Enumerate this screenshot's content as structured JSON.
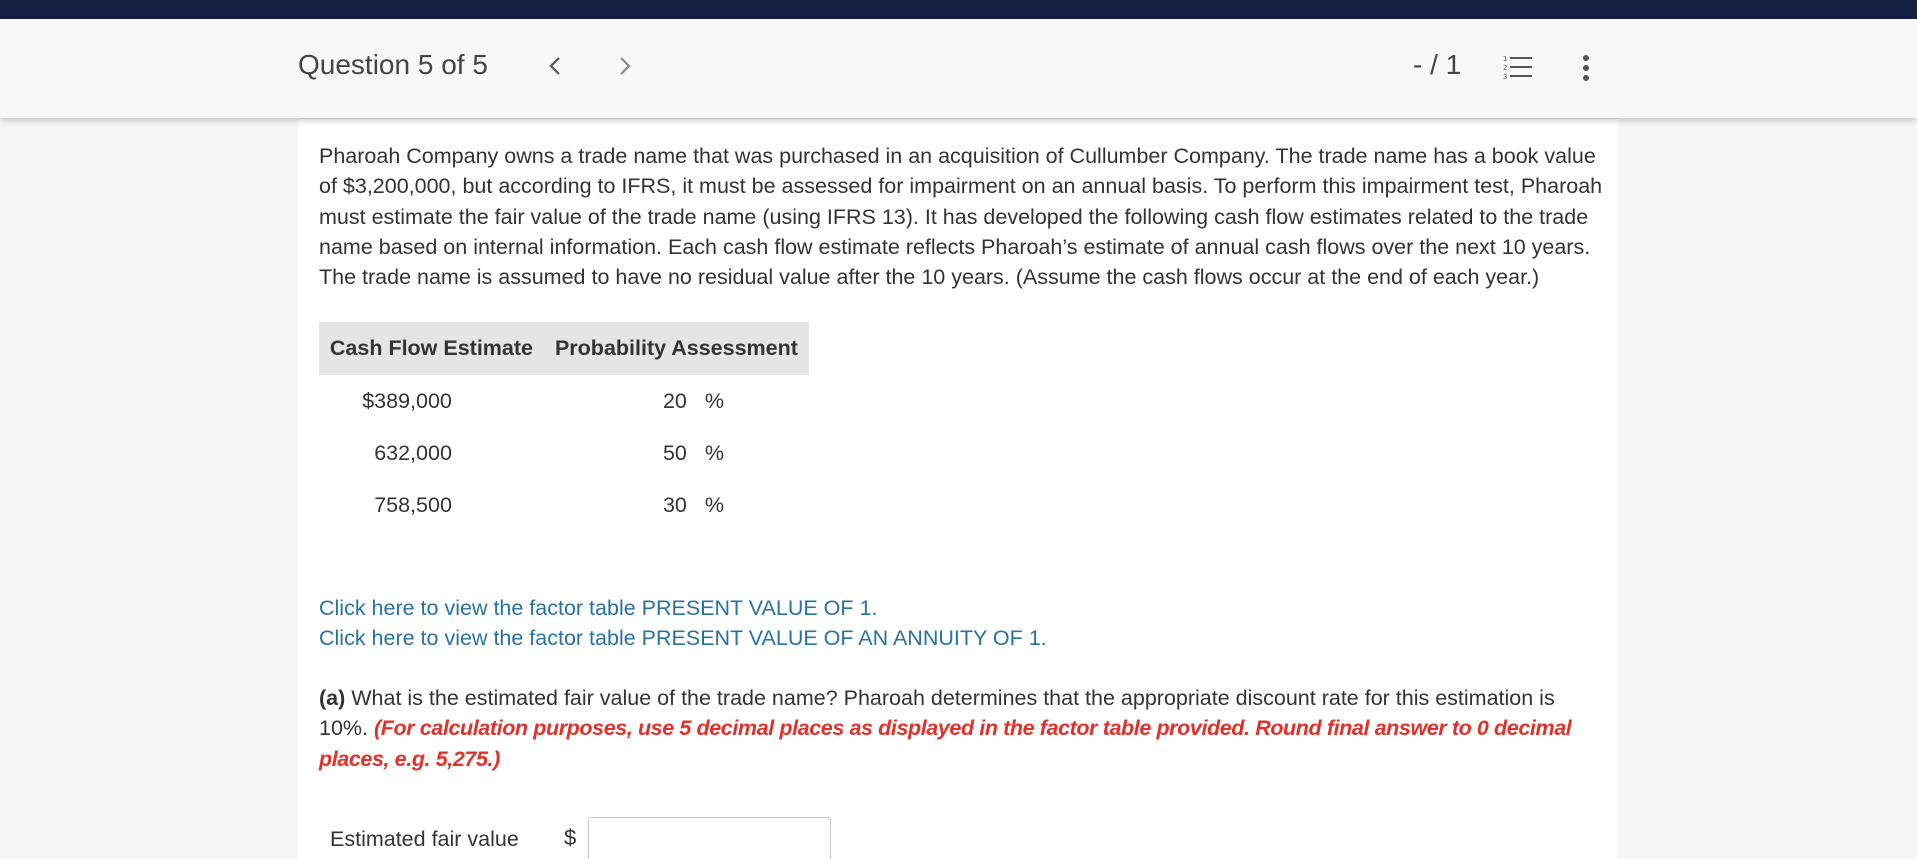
{
  "header": {
    "question_title": "Question 5 of 5",
    "score": "- / 1",
    "icons": {
      "prev": "chevron-left-icon",
      "next": "chevron-right-icon",
      "list": "numbered-list-icon",
      "more": "vertical-dots-icon"
    }
  },
  "prompt": "Pharoah Company owns a trade name that was purchased in an acquisition of Cullumber Company. The trade name has a book value of $3,200,000, but according to IFRS, it must be assessed for impairment on an annual basis. To perform this impairment test, Pharoah must estimate the fair value of the trade name (using IFRS 13). It has developed the following cash flow estimates related to the trade name based on internal information. Each cash flow estimate reflects Pharoah’s estimate of annual cash flows over the next 10 years. The trade name is assumed to have no residual value after the 10 years. (Assume the cash flows occur at the end of each year.)",
  "table": {
    "headers": [
      "Cash Flow Estimate",
      "Probability Assessment"
    ],
    "rows": [
      {
        "amount": "$389,000",
        "probability": "20",
        "unit": "%"
      },
      {
        "amount": "632,000",
        "probability": "50",
        "unit": "%"
      },
      {
        "amount": "758,500",
        "probability": "30",
        "unit": "%"
      }
    ]
  },
  "links": [
    "Click here to view the factor table PRESENT VALUE OF 1.",
    "Click here to view the factor table PRESENT VALUE OF AN ANNUITY OF 1."
  ],
  "part_a": {
    "label": "(a)",
    "question": " What is the estimated fair value of the trade name? Pharoah determines that the appropriate discount rate for this estimation is 10%. ",
    "instruction": "(For calculation purposes, use 5 decimal places as displayed in the factor table provided. Round final answer to 0 decimal places, e.g. 5,275.)"
  },
  "answer": {
    "label": "Estimated fair value",
    "currency": "$",
    "value": ""
  },
  "colors": {
    "top_strip": "#141f44",
    "link": "#2872a1",
    "instruction": "#e0312a",
    "table_header_bg": "#e5e5e5"
  }
}
